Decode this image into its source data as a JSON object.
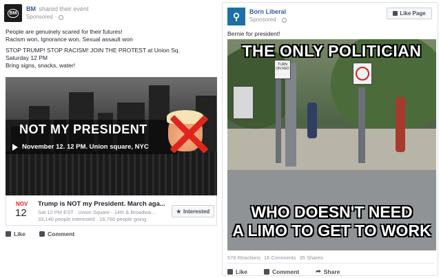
{
  "left_post": {
    "page_name": "BM",
    "action_text": "shared their event",
    "avatar_text": "BM",
    "sponsored": "Sponsored ·",
    "body_lines": [
      "People are genuinely scared for their futures!",
      "Racism won, Ignorance won, Sexual assault won",
      "STOP TRUMP! STOP RACISM! JOIN THE PROTEST at Union Sq.",
      "Saturday 12 PM",
      "Bring signs, snacks, water!"
    ],
    "image": {
      "headline": "NOT MY PRESIDENT",
      "subline": "November 12. 12 PM. Union square, NYC"
    },
    "event": {
      "month": "NOV",
      "day": "12",
      "title": "Trump is NOT my President. March aga...",
      "meta": "Sat 12 PM EST · Union Square - 14th & Broadwa...",
      "counts": "33,140 people interested · 16,760 people going",
      "interested_label": "Interested"
    },
    "actions": {
      "like": "Like",
      "comment": "Comment"
    }
  },
  "right_post": {
    "page_name": "Born Liberal",
    "sponsored": "Sponsored ·",
    "like_page_label": "Like Page",
    "body_text": "Bernie for president!",
    "meme": {
      "top_text": "THE ONLY POLITICIAN",
      "bottom_line1": "WHO DOESN'T NEED",
      "bottom_line2": "A LIMO TO GET TO WORK",
      "sign_text": "TURN ON RED"
    },
    "reactions": {
      "count": "578 Reactions",
      "comments": "16 Comments",
      "shares": "35 Shares"
    },
    "actions": {
      "like": "Like",
      "comment": "Comment",
      "share": "Share"
    }
  },
  "colors": {
    "link": "#365899",
    "meta": "#90949c",
    "text": "#1d2129",
    "red": "#e0261c",
    "brand_blue": "#1c6fa8"
  }
}
